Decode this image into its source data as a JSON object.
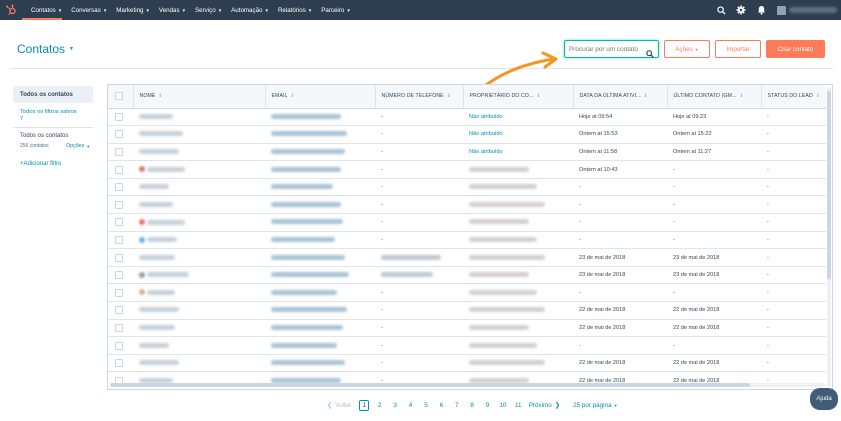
{
  "nav": {
    "items": [
      {
        "label": "Contatos"
      },
      {
        "label": "Conversas"
      },
      {
        "label": "Marketing"
      },
      {
        "label": "Vendas"
      },
      {
        "label": "Serviço"
      },
      {
        "label": "Automação"
      },
      {
        "label": "Relatórios"
      },
      {
        "label": "Parceiro"
      }
    ],
    "right_icons": [
      "search-icon",
      "gear-icon",
      "bell-icon"
    ],
    "brand_color": "#ff7a59",
    "bar_color": "#2d3e50"
  },
  "header": {
    "title": "Contatos",
    "search_placeholder": "Procurar por um contato",
    "acoes_label": "Ações",
    "importar_label": "Importar",
    "criar_label": "Criar contato"
  },
  "sidebar": {
    "active_view": "Todos os contatos",
    "saved_filters_link": "Todos os filtros salvos",
    "saved_filters_note": "7",
    "all_title": "Todos os contatos",
    "count": "256 contatos",
    "options_label": "Opções",
    "add_filter": "+Adicionar filtro"
  },
  "table": {
    "columns": [
      "NOME",
      "EMAIL",
      "NÚMERO DE TELEFONE",
      "PROPRIETÁRIO DO CO...",
      "DATA DA ÚLTIMA ATIVI...",
      "ÚLTIMO CONTATO (GM...",
      "STATUS DO LEAD"
    ],
    "rows": [
      {
        "phone": "-",
        "owner": "Não atribuído",
        "last_activity": "Hoje at 09:54",
        "last_contact": "Hoje at 09:23",
        "status": "-"
      },
      {
        "phone": "-",
        "owner": "Não atribuído",
        "last_activity": "Ontem at 15:53",
        "last_contact": "Ontem at 15:22",
        "status": "-"
      },
      {
        "phone": "-",
        "owner": "Não atribuído",
        "last_activity": "Ontem at 11:58",
        "last_contact": "Ontem at 11:27",
        "status": "-"
      },
      {
        "phone": "-",
        "owner": "",
        "last_activity": "Ontem at 10:43",
        "last_contact": "-",
        "status": "-"
      },
      {
        "phone": "-",
        "owner": "",
        "last_activity": "-",
        "last_contact": "-",
        "status": "-"
      },
      {
        "phone": "-",
        "owner": "",
        "last_activity": "-",
        "last_contact": "-",
        "status": "-"
      },
      {
        "phone": "-",
        "owner": "",
        "last_activity": "-",
        "last_contact": "-",
        "status": "-"
      },
      {
        "phone": "-",
        "owner": "",
        "last_activity": "-",
        "last_contact": "-",
        "status": "-"
      },
      {
        "phone": "",
        "owner": "",
        "last_activity": "23 de mai de 2018",
        "last_contact": "23 de mai de 2018",
        "status": "-"
      },
      {
        "phone": "",
        "owner": "",
        "last_activity": "23 de mai de 2018",
        "last_contact": "23 de mai de 2018",
        "status": "-"
      },
      {
        "phone": "-",
        "owner": "",
        "last_activity": "-",
        "last_contact": "-",
        "status": "-"
      },
      {
        "phone": "-",
        "owner": "",
        "last_activity": "22 de mai de 2018",
        "last_contact": "22 de mai de 2018",
        "status": "-"
      },
      {
        "phone": "-",
        "owner": "",
        "last_activity": "22 de mai de 2018",
        "last_contact": "22 de mai de 2018",
        "status": "-"
      },
      {
        "phone": "-",
        "owner": "",
        "last_activity": "-",
        "last_contact": "-",
        "status": "-"
      },
      {
        "phone": "-",
        "owner": "",
        "last_activity": "22 de mai de 2018",
        "last_contact": "22 de mai de 2018",
        "status": "-"
      },
      {
        "phone": "-",
        "owner": "",
        "last_activity": "22 de mai de 2018",
        "last_contact": "22 de mai de 2018",
        "status": "-"
      }
    ]
  },
  "pagination": {
    "prev_label": "Voltar",
    "pages": [
      "1",
      "2",
      "3",
      "4",
      "5",
      "6",
      "7",
      "8",
      "9",
      "10",
      "11"
    ],
    "current_page": "1",
    "next_label": "Próximo",
    "per_page_label": "25 por página"
  },
  "help_label": "Ajuda"
}
